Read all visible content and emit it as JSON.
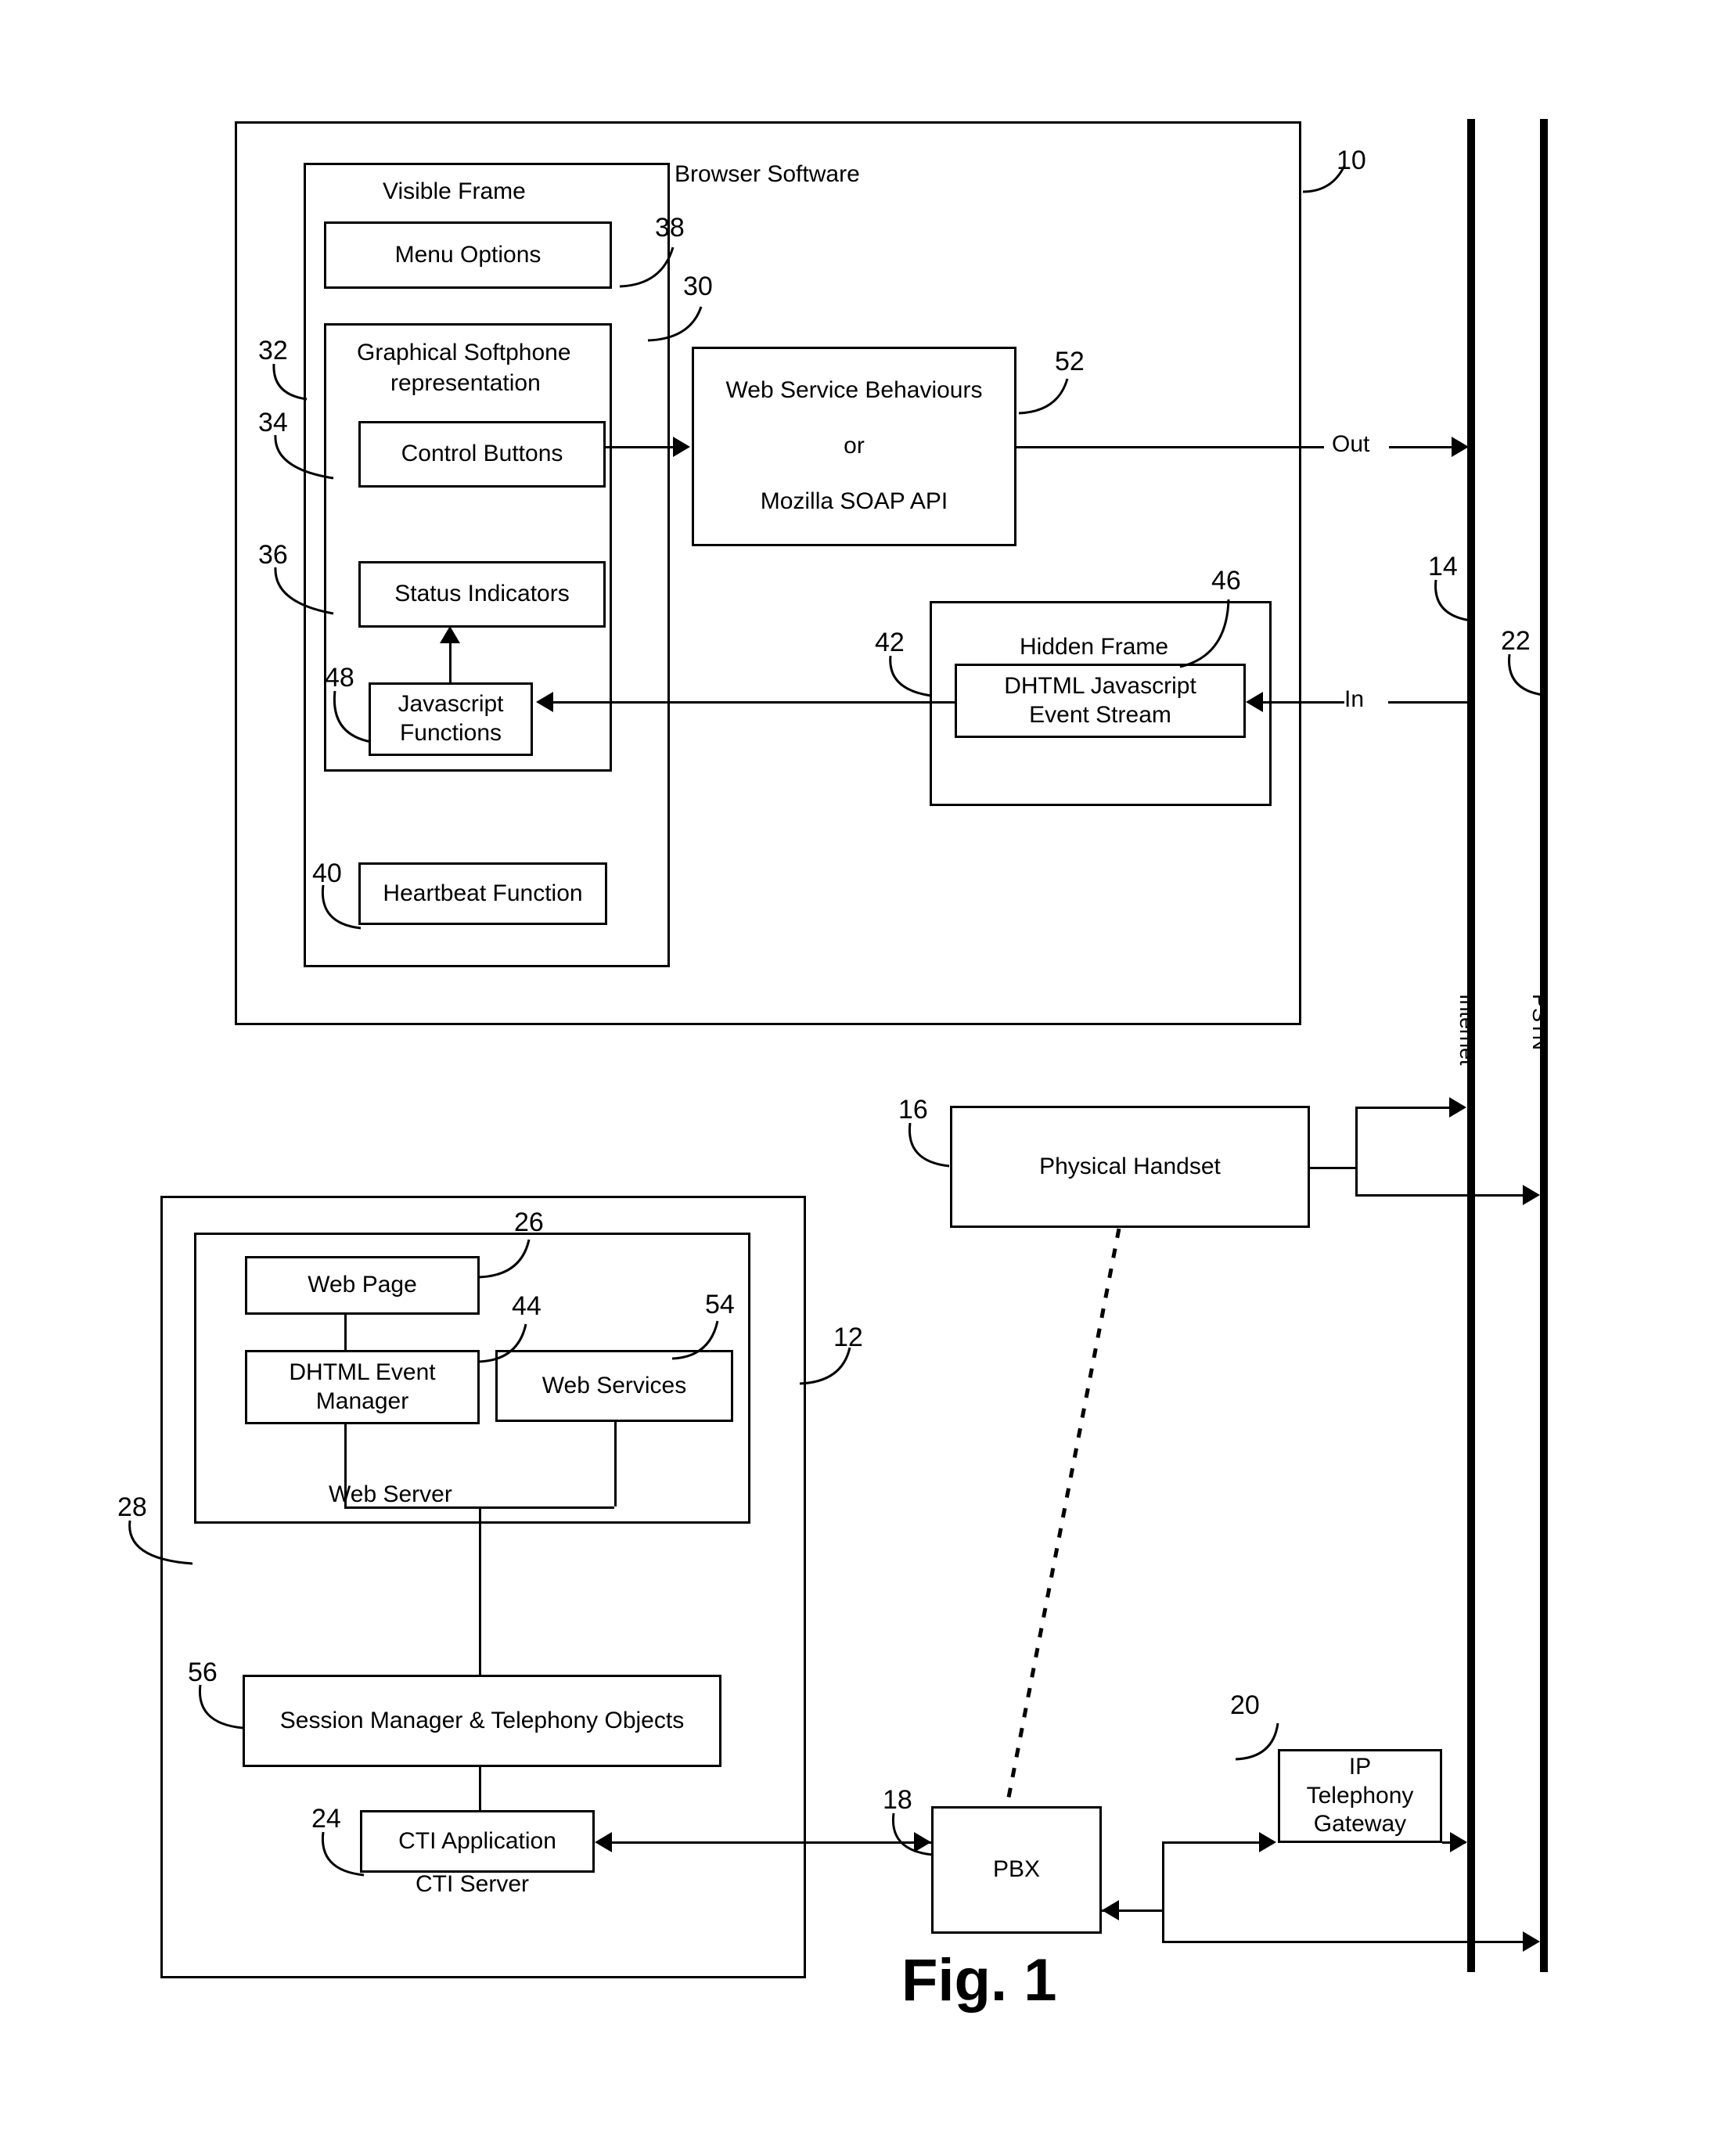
{
  "figure": {
    "caption": "Fig. 1"
  },
  "browser": {
    "title": "Browser Software",
    "ref": "10",
    "visible_frame": {
      "title": "Visible Frame",
      "ref": "32"
    },
    "menu_options": {
      "label": "Menu Options",
      "ref": "38"
    },
    "softphone": {
      "label_line1": "Graphical Softphone",
      "label_line2": "representation",
      "ref": "30"
    },
    "control_buttons": {
      "label": "Control Buttons",
      "ref": "34"
    },
    "status_indicators": {
      "label": "Status Indicators",
      "ref": "36"
    },
    "javascript_functions": {
      "label_line1": "Javascript",
      "label_line2": "Functions",
      "ref": "48"
    },
    "heartbeat": {
      "label": "Heartbeat Function",
      "ref": "40"
    },
    "web_service": {
      "line1": "Web Service Behaviours",
      "line2": "or",
      "line3": "Mozilla SOAP API",
      "ref": "52"
    },
    "hidden_frame": {
      "title": "Hidden Frame",
      "ref": "42"
    },
    "event_stream": {
      "label_line1": "DHTML Javascript",
      "label_line2": "Event Stream",
      "ref": "46"
    }
  },
  "flow_labels": {
    "out": "Out",
    "in": "In"
  },
  "networks": {
    "internet": {
      "label": "Internet",
      "ref": "14"
    },
    "pstn": {
      "label": "PSTN",
      "ref": "22"
    }
  },
  "handset": {
    "label": "Physical Handset",
    "ref": "16"
  },
  "cti_server": {
    "title": "CTI Server",
    "ref": "12",
    "web_server": {
      "title": "Web Server",
      "ref": "28"
    },
    "web_page": {
      "label": "Web Page",
      "ref": "26"
    },
    "dhtml_event_manager": {
      "label_line1": "DHTML Event",
      "label_line2": "Manager",
      "ref": "44"
    },
    "web_services": {
      "label": "Web Services",
      "ref": "54"
    },
    "session_manager": {
      "label": "Session Manager & Telephony Objects",
      "ref": "56"
    },
    "cti_application": {
      "label": "CTI Application",
      "ref": "24"
    }
  },
  "pbx": {
    "label": "PBX",
    "ref": "18"
  },
  "ip_gateway": {
    "label_line1": "IP",
    "label_line2": "Telephony",
    "label_line3": "Gateway",
    "ref": "20"
  },
  "colors": {
    "ink": "#000000",
    "paper": "#ffffff"
  }
}
